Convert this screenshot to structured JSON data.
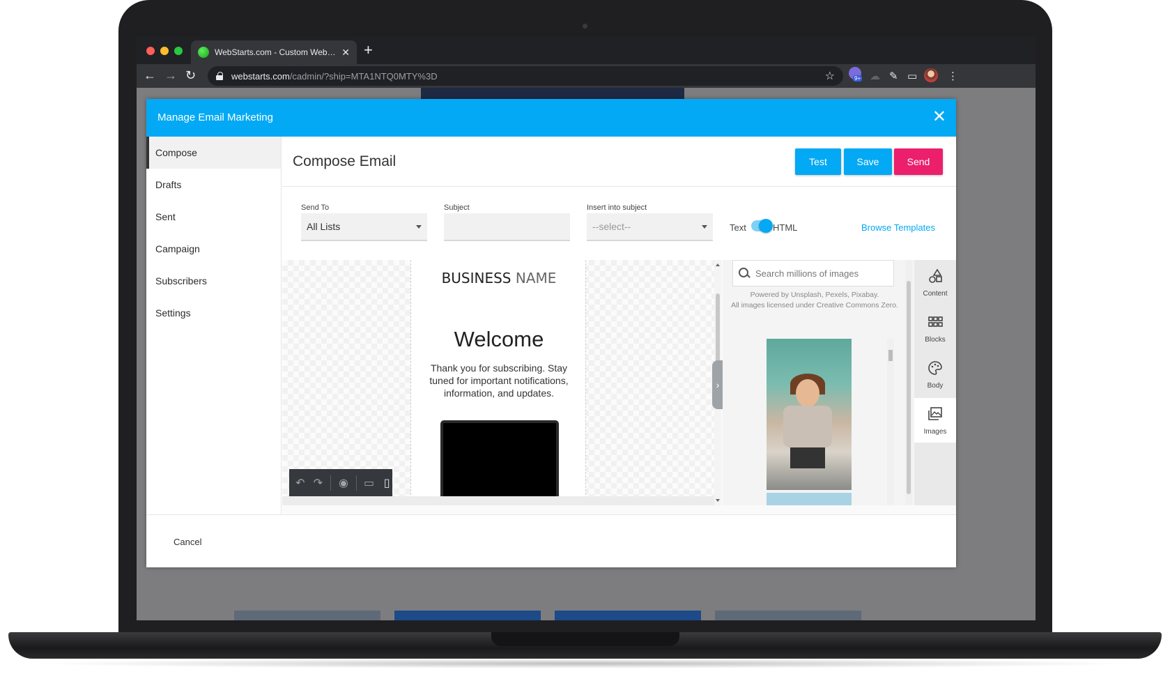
{
  "browser": {
    "tab_title": "WebStarts.com - Custom Web…",
    "tab_close": "✕",
    "new_tab": "+",
    "url_host": "webstarts.com",
    "url_path": "/cadmin/?ship=MTA1NTQ0MTY%3D",
    "ext_badge": "9+"
  },
  "modal": {
    "title": "Manage Email Marketing",
    "close": "✕",
    "cancel_label": "Cancel"
  },
  "sidebar": {
    "items": [
      {
        "label": "Compose"
      },
      {
        "label": "Drafts"
      },
      {
        "label": "Sent"
      },
      {
        "label": "Campaign"
      },
      {
        "label": "Subscribers"
      },
      {
        "label": "Settings"
      }
    ]
  },
  "compose": {
    "title": "Compose Email",
    "buttons": {
      "test": "Test",
      "save": "Save",
      "send": "Send"
    },
    "send_to": {
      "label": "Send To",
      "value": "All Lists"
    },
    "subject": {
      "label": "Subject",
      "value": ""
    },
    "insert": {
      "label": "Insert into subject",
      "value": "--select--"
    },
    "toggle": {
      "left": "Text",
      "right": "HTML",
      "state": "HTML"
    },
    "browse_templates": "Browse Templates"
  },
  "email_preview": {
    "business_bold": "BUSINESS",
    "business_light": "NAME",
    "heading": "Welcome",
    "body": "Thank you for subscribing. Stay tuned for important notifications, information, and updates."
  },
  "images_panel": {
    "search_placeholder": "Search millions of images",
    "credit_line1": "Powered by Unsplash, Pexels, Pixabay.",
    "credit_line2": "All images licensed under Creative Commons Zero."
  },
  "side_tabs": [
    {
      "label": "Content",
      "icon": "shapes-icon"
    },
    {
      "label": "Blocks",
      "icon": "grid-icon"
    },
    {
      "label": "Body",
      "icon": "palette-icon"
    },
    {
      "label": "Images",
      "icon": "images-icon"
    }
  ],
  "active_side_tab": "Images",
  "colors": {
    "accent": "#03a9f4",
    "send": "#ec1f6c"
  }
}
